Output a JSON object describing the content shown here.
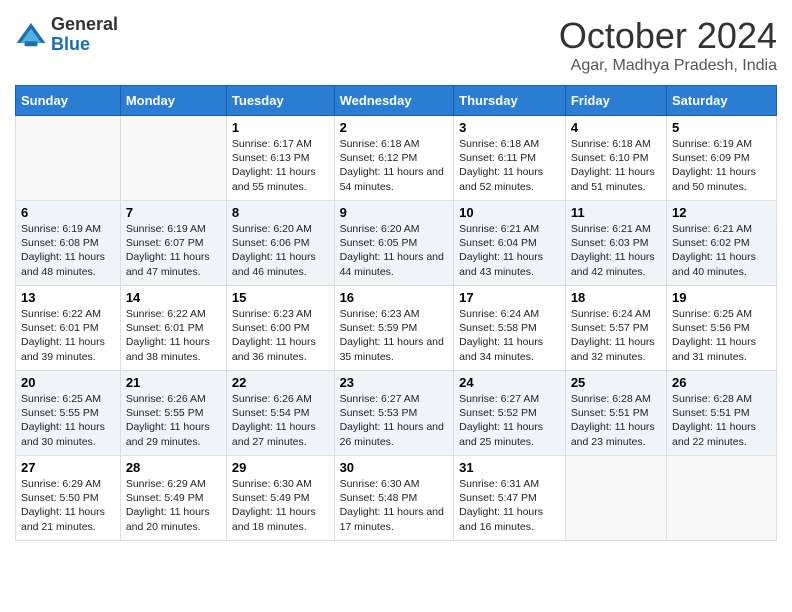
{
  "logo": {
    "general": "General",
    "blue": "Blue"
  },
  "title": "October 2024",
  "location": "Agar, Madhya Pradesh, India",
  "weekdays": [
    "Sunday",
    "Monday",
    "Tuesday",
    "Wednesday",
    "Thursday",
    "Friday",
    "Saturday"
  ],
  "weeks": [
    [
      {
        "day": "",
        "sunrise": "",
        "sunset": "",
        "daylight": ""
      },
      {
        "day": "",
        "sunrise": "",
        "sunset": "",
        "daylight": ""
      },
      {
        "day": "1",
        "sunrise": "Sunrise: 6:17 AM",
        "sunset": "Sunset: 6:13 PM",
        "daylight": "Daylight: 11 hours and 55 minutes."
      },
      {
        "day": "2",
        "sunrise": "Sunrise: 6:18 AM",
        "sunset": "Sunset: 6:12 PM",
        "daylight": "Daylight: 11 hours and 54 minutes."
      },
      {
        "day": "3",
        "sunrise": "Sunrise: 6:18 AM",
        "sunset": "Sunset: 6:11 PM",
        "daylight": "Daylight: 11 hours and 52 minutes."
      },
      {
        "day": "4",
        "sunrise": "Sunrise: 6:18 AM",
        "sunset": "Sunset: 6:10 PM",
        "daylight": "Daylight: 11 hours and 51 minutes."
      },
      {
        "day": "5",
        "sunrise": "Sunrise: 6:19 AM",
        "sunset": "Sunset: 6:09 PM",
        "daylight": "Daylight: 11 hours and 50 minutes."
      }
    ],
    [
      {
        "day": "6",
        "sunrise": "Sunrise: 6:19 AM",
        "sunset": "Sunset: 6:08 PM",
        "daylight": "Daylight: 11 hours and 48 minutes."
      },
      {
        "day": "7",
        "sunrise": "Sunrise: 6:19 AM",
        "sunset": "Sunset: 6:07 PM",
        "daylight": "Daylight: 11 hours and 47 minutes."
      },
      {
        "day": "8",
        "sunrise": "Sunrise: 6:20 AM",
        "sunset": "Sunset: 6:06 PM",
        "daylight": "Daylight: 11 hours and 46 minutes."
      },
      {
        "day": "9",
        "sunrise": "Sunrise: 6:20 AM",
        "sunset": "Sunset: 6:05 PM",
        "daylight": "Daylight: 11 hours and 44 minutes."
      },
      {
        "day": "10",
        "sunrise": "Sunrise: 6:21 AM",
        "sunset": "Sunset: 6:04 PM",
        "daylight": "Daylight: 11 hours and 43 minutes."
      },
      {
        "day": "11",
        "sunrise": "Sunrise: 6:21 AM",
        "sunset": "Sunset: 6:03 PM",
        "daylight": "Daylight: 11 hours and 42 minutes."
      },
      {
        "day": "12",
        "sunrise": "Sunrise: 6:21 AM",
        "sunset": "Sunset: 6:02 PM",
        "daylight": "Daylight: 11 hours and 40 minutes."
      }
    ],
    [
      {
        "day": "13",
        "sunrise": "Sunrise: 6:22 AM",
        "sunset": "Sunset: 6:01 PM",
        "daylight": "Daylight: 11 hours and 39 minutes."
      },
      {
        "day": "14",
        "sunrise": "Sunrise: 6:22 AM",
        "sunset": "Sunset: 6:01 PM",
        "daylight": "Daylight: 11 hours and 38 minutes."
      },
      {
        "day": "15",
        "sunrise": "Sunrise: 6:23 AM",
        "sunset": "Sunset: 6:00 PM",
        "daylight": "Daylight: 11 hours and 36 minutes."
      },
      {
        "day": "16",
        "sunrise": "Sunrise: 6:23 AM",
        "sunset": "Sunset: 5:59 PM",
        "daylight": "Daylight: 11 hours and 35 minutes."
      },
      {
        "day": "17",
        "sunrise": "Sunrise: 6:24 AM",
        "sunset": "Sunset: 5:58 PM",
        "daylight": "Daylight: 11 hours and 34 minutes."
      },
      {
        "day": "18",
        "sunrise": "Sunrise: 6:24 AM",
        "sunset": "Sunset: 5:57 PM",
        "daylight": "Daylight: 11 hours and 32 minutes."
      },
      {
        "day": "19",
        "sunrise": "Sunrise: 6:25 AM",
        "sunset": "Sunset: 5:56 PM",
        "daylight": "Daylight: 11 hours and 31 minutes."
      }
    ],
    [
      {
        "day": "20",
        "sunrise": "Sunrise: 6:25 AM",
        "sunset": "Sunset: 5:55 PM",
        "daylight": "Daylight: 11 hours and 30 minutes."
      },
      {
        "day": "21",
        "sunrise": "Sunrise: 6:26 AM",
        "sunset": "Sunset: 5:55 PM",
        "daylight": "Daylight: 11 hours and 29 minutes."
      },
      {
        "day": "22",
        "sunrise": "Sunrise: 6:26 AM",
        "sunset": "Sunset: 5:54 PM",
        "daylight": "Daylight: 11 hours and 27 minutes."
      },
      {
        "day": "23",
        "sunrise": "Sunrise: 6:27 AM",
        "sunset": "Sunset: 5:53 PM",
        "daylight": "Daylight: 11 hours and 26 minutes."
      },
      {
        "day": "24",
        "sunrise": "Sunrise: 6:27 AM",
        "sunset": "Sunset: 5:52 PM",
        "daylight": "Daylight: 11 hours and 25 minutes."
      },
      {
        "day": "25",
        "sunrise": "Sunrise: 6:28 AM",
        "sunset": "Sunset: 5:51 PM",
        "daylight": "Daylight: 11 hours and 23 minutes."
      },
      {
        "day": "26",
        "sunrise": "Sunrise: 6:28 AM",
        "sunset": "Sunset: 5:51 PM",
        "daylight": "Daylight: 11 hours and 22 minutes."
      }
    ],
    [
      {
        "day": "27",
        "sunrise": "Sunrise: 6:29 AM",
        "sunset": "Sunset: 5:50 PM",
        "daylight": "Daylight: 11 hours and 21 minutes."
      },
      {
        "day": "28",
        "sunrise": "Sunrise: 6:29 AM",
        "sunset": "Sunset: 5:49 PM",
        "daylight": "Daylight: 11 hours and 20 minutes."
      },
      {
        "day": "29",
        "sunrise": "Sunrise: 6:30 AM",
        "sunset": "Sunset: 5:49 PM",
        "daylight": "Daylight: 11 hours and 18 minutes."
      },
      {
        "day": "30",
        "sunrise": "Sunrise: 6:30 AM",
        "sunset": "Sunset: 5:48 PM",
        "daylight": "Daylight: 11 hours and 17 minutes."
      },
      {
        "day": "31",
        "sunrise": "Sunrise: 6:31 AM",
        "sunset": "Sunset: 5:47 PM",
        "daylight": "Daylight: 11 hours and 16 minutes."
      },
      {
        "day": "",
        "sunrise": "",
        "sunset": "",
        "daylight": ""
      },
      {
        "day": "",
        "sunrise": "",
        "sunset": "",
        "daylight": ""
      }
    ]
  ]
}
